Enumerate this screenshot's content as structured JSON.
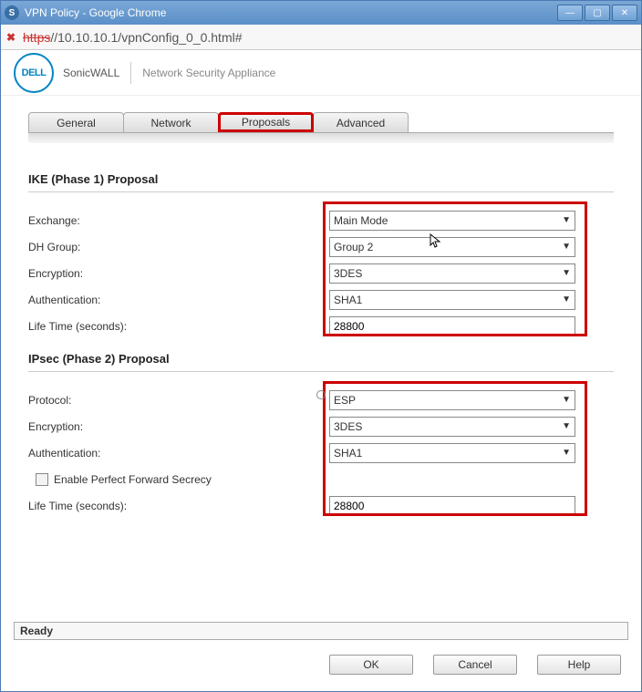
{
  "window": {
    "title": "VPN Policy - Google Chrome"
  },
  "address": {
    "protocol_struck": "https",
    "url": "//10.10.10.1/vpnConfig_0_0.html#"
  },
  "brand": {
    "logo": "DELL",
    "product": "SonicWALL",
    "appliance": "Network Security Appliance"
  },
  "tabs": [
    {
      "label": "General"
    },
    {
      "label": "Network"
    },
    {
      "label": "Proposals"
    },
    {
      "label": "Advanced"
    }
  ],
  "phase1": {
    "title": "IKE (Phase 1) Proposal",
    "rows": {
      "exchange": {
        "label": "Exchange:",
        "value": "Main Mode"
      },
      "dhgroup": {
        "label": "DH Group:",
        "value": "Group 2"
      },
      "encryption": {
        "label": "Encryption:",
        "value": "3DES"
      },
      "auth": {
        "label": "Authentication:",
        "value": "SHA1"
      },
      "life": {
        "label": "Life Time (seconds):",
        "value": "28800"
      }
    }
  },
  "phase2": {
    "title": "IPsec (Phase 2) Proposal",
    "rows": {
      "protocol": {
        "label": "Protocol:",
        "value": "ESP"
      },
      "encryption": {
        "label": "Encryption:",
        "value": "3DES"
      },
      "auth": {
        "label": "Authentication:",
        "value": "SHA1"
      },
      "pfs": {
        "label": "Enable Perfect Forward Secrecy"
      },
      "life": {
        "label": "Life Time (seconds):",
        "value": "28800"
      }
    }
  },
  "status": {
    "text": "Ready"
  },
  "buttons": {
    "ok": "OK",
    "cancel": "Cancel",
    "help": "Help"
  }
}
